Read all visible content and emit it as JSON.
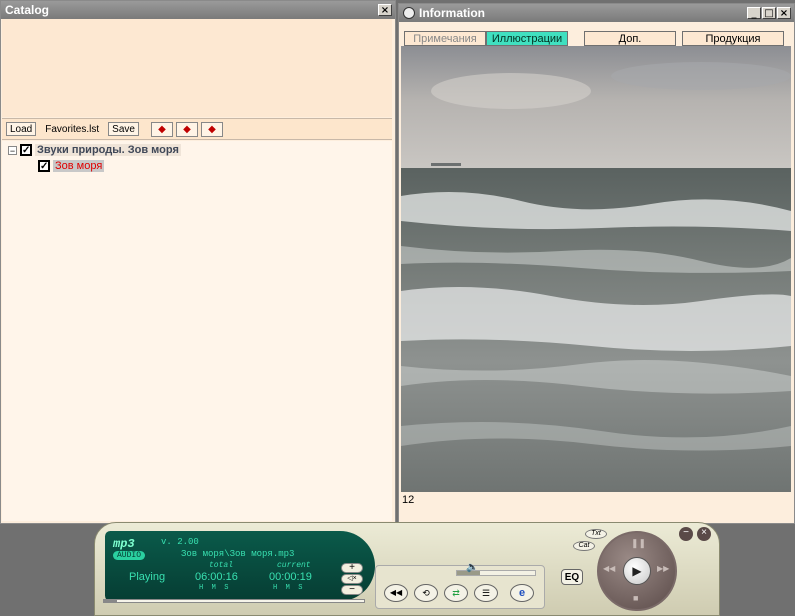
{
  "catalog": {
    "title": "Catalog",
    "close": "×",
    "toolbar": {
      "load": "Load",
      "list_name": "Favorites.lst",
      "save": "Save",
      "move_all": "◆",
      "move_up_down": "◆",
      "move_bottom": "◆"
    },
    "tree": {
      "expander": "−",
      "root_label": "Звуки природы. Зов моря",
      "child_label": "Зов моря",
      "check": "✓"
    }
  },
  "information": {
    "title": "Information",
    "buttons": {
      "minimize": "_",
      "maximize": "□",
      "close": "×"
    },
    "tabs": [
      {
        "label": "Примечания"
      },
      {
        "label": "Иллюстрации"
      },
      {
        "label": "Доп. информация"
      },
      {
        "label": "Продукция"
      }
    ],
    "page_number": "12"
  },
  "player": {
    "logo": "mp3",
    "logo_sub": "AUDIO",
    "version": "v. 2.00",
    "track": "Зов моря\\Зов моря.mp3",
    "state": "Playing",
    "total_label": "total",
    "total": "06:00:16",
    "current_label": "current",
    "current": "00:00:19",
    "hms": "H  M  S",
    "eq_label": "EQ",
    "plus": "+",
    "minus": "−",
    "mute": "◁×",
    "play": "▶",
    "pause": "❚❚",
    "prev": "◀◀",
    "next": "▶▶",
    "stop": "■",
    "txt_label": "Txt",
    "cat_label": "Cat",
    "volume": 0.3,
    "progress": 0.05
  }
}
